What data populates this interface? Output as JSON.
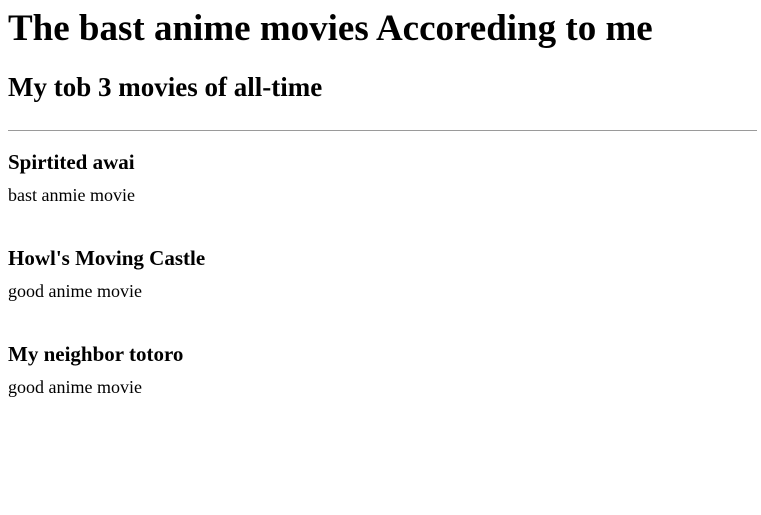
{
  "page": {
    "heading": "The bast anime movies Accoreding to me",
    "subheading": "My tob 3 movies of all-time"
  },
  "movies": [
    {
      "title": "Spirtited awai",
      "description": "bast anmie movie"
    },
    {
      "title": "Howl's Moving Castle",
      "description": "good anime movie"
    },
    {
      "title": "My neighbor totoro",
      "description": "good anime movie"
    }
  ]
}
